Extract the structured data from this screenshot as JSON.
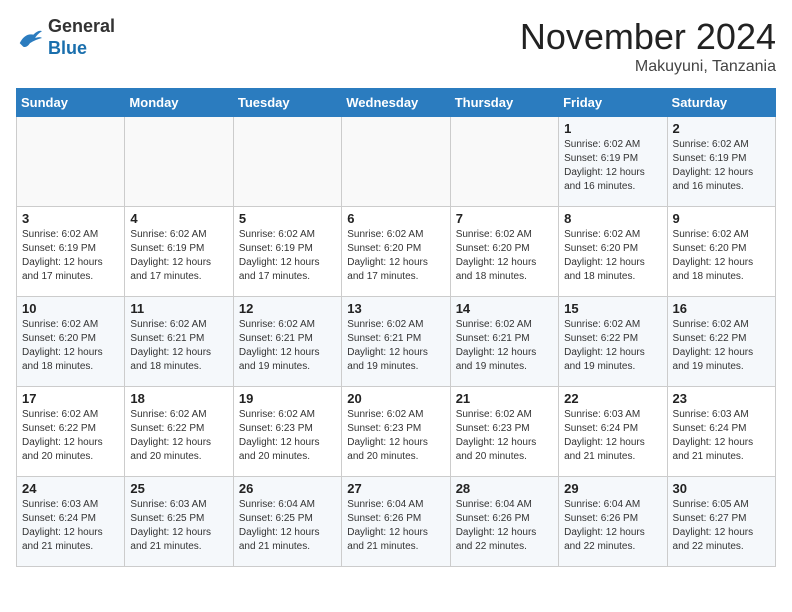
{
  "header": {
    "logo_general": "General",
    "logo_blue": "Blue",
    "month_title": "November 2024",
    "location": "Makuyuni, Tanzania"
  },
  "weekdays": [
    "Sunday",
    "Monday",
    "Tuesday",
    "Wednesday",
    "Thursday",
    "Friday",
    "Saturday"
  ],
  "weeks": [
    [
      {
        "day": "",
        "info": ""
      },
      {
        "day": "",
        "info": ""
      },
      {
        "day": "",
        "info": ""
      },
      {
        "day": "",
        "info": ""
      },
      {
        "day": "",
        "info": ""
      },
      {
        "day": "1",
        "info": "Sunrise: 6:02 AM\nSunset: 6:19 PM\nDaylight: 12 hours and 16 minutes."
      },
      {
        "day": "2",
        "info": "Sunrise: 6:02 AM\nSunset: 6:19 PM\nDaylight: 12 hours and 16 minutes."
      }
    ],
    [
      {
        "day": "3",
        "info": "Sunrise: 6:02 AM\nSunset: 6:19 PM\nDaylight: 12 hours and 17 minutes."
      },
      {
        "day": "4",
        "info": "Sunrise: 6:02 AM\nSunset: 6:19 PM\nDaylight: 12 hours and 17 minutes."
      },
      {
        "day": "5",
        "info": "Sunrise: 6:02 AM\nSunset: 6:19 PM\nDaylight: 12 hours and 17 minutes."
      },
      {
        "day": "6",
        "info": "Sunrise: 6:02 AM\nSunset: 6:20 PM\nDaylight: 12 hours and 17 minutes."
      },
      {
        "day": "7",
        "info": "Sunrise: 6:02 AM\nSunset: 6:20 PM\nDaylight: 12 hours and 18 minutes."
      },
      {
        "day": "8",
        "info": "Sunrise: 6:02 AM\nSunset: 6:20 PM\nDaylight: 12 hours and 18 minutes."
      },
      {
        "day": "9",
        "info": "Sunrise: 6:02 AM\nSunset: 6:20 PM\nDaylight: 12 hours and 18 minutes."
      }
    ],
    [
      {
        "day": "10",
        "info": "Sunrise: 6:02 AM\nSunset: 6:20 PM\nDaylight: 12 hours and 18 minutes."
      },
      {
        "day": "11",
        "info": "Sunrise: 6:02 AM\nSunset: 6:21 PM\nDaylight: 12 hours and 18 minutes."
      },
      {
        "day": "12",
        "info": "Sunrise: 6:02 AM\nSunset: 6:21 PM\nDaylight: 12 hours and 19 minutes."
      },
      {
        "day": "13",
        "info": "Sunrise: 6:02 AM\nSunset: 6:21 PM\nDaylight: 12 hours and 19 minutes."
      },
      {
        "day": "14",
        "info": "Sunrise: 6:02 AM\nSunset: 6:21 PM\nDaylight: 12 hours and 19 minutes."
      },
      {
        "day": "15",
        "info": "Sunrise: 6:02 AM\nSunset: 6:22 PM\nDaylight: 12 hours and 19 minutes."
      },
      {
        "day": "16",
        "info": "Sunrise: 6:02 AM\nSunset: 6:22 PM\nDaylight: 12 hours and 19 minutes."
      }
    ],
    [
      {
        "day": "17",
        "info": "Sunrise: 6:02 AM\nSunset: 6:22 PM\nDaylight: 12 hours and 20 minutes."
      },
      {
        "day": "18",
        "info": "Sunrise: 6:02 AM\nSunset: 6:22 PM\nDaylight: 12 hours and 20 minutes."
      },
      {
        "day": "19",
        "info": "Sunrise: 6:02 AM\nSunset: 6:23 PM\nDaylight: 12 hours and 20 minutes."
      },
      {
        "day": "20",
        "info": "Sunrise: 6:02 AM\nSunset: 6:23 PM\nDaylight: 12 hours and 20 minutes."
      },
      {
        "day": "21",
        "info": "Sunrise: 6:02 AM\nSunset: 6:23 PM\nDaylight: 12 hours and 20 minutes."
      },
      {
        "day": "22",
        "info": "Sunrise: 6:03 AM\nSunset: 6:24 PM\nDaylight: 12 hours and 21 minutes."
      },
      {
        "day": "23",
        "info": "Sunrise: 6:03 AM\nSunset: 6:24 PM\nDaylight: 12 hours and 21 minutes."
      }
    ],
    [
      {
        "day": "24",
        "info": "Sunrise: 6:03 AM\nSunset: 6:24 PM\nDaylight: 12 hours and 21 minutes."
      },
      {
        "day": "25",
        "info": "Sunrise: 6:03 AM\nSunset: 6:25 PM\nDaylight: 12 hours and 21 minutes."
      },
      {
        "day": "26",
        "info": "Sunrise: 6:04 AM\nSunset: 6:25 PM\nDaylight: 12 hours and 21 minutes."
      },
      {
        "day": "27",
        "info": "Sunrise: 6:04 AM\nSunset: 6:26 PM\nDaylight: 12 hours and 21 minutes."
      },
      {
        "day": "28",
        "info": "Sunrise: 6:04 AM\nSunset: 6:26 PM\nDaylight: 12 hours and 22 minutes."
      },
      {
        "day": "29",
        "info": "Sunrise: 6:04 AM\nSunset: 6:26 PM\nDaylight: 12 hours and 22 minutes."
      },
      {
        "day": "30",
        "info": "Sunrise: 6:05 AM\nSunset: 6:27 PM\nDaylight: 12 hours and 22 minutes."
      }
    ]
  ]
}
